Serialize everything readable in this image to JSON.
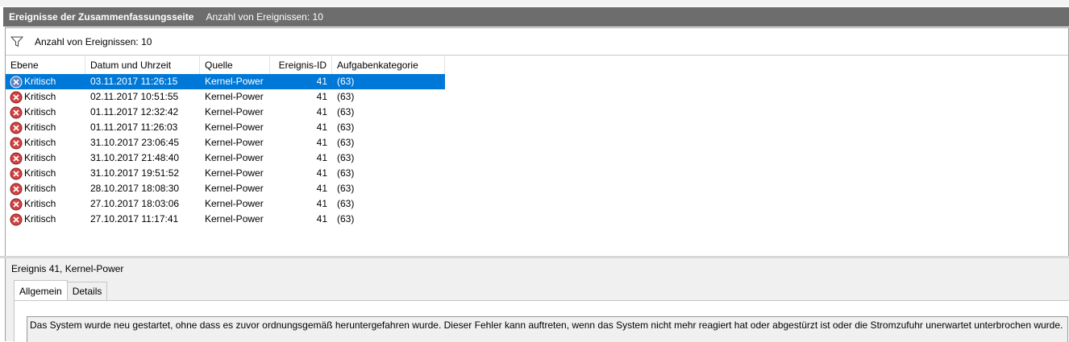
{
  "window": {
    "title": "Ereignisse der Zusammenfassungsseite",
    "count_label": "Anzahl von Ereignissen: 10"
  },
  "filter": {
    "icon": "filter-icon",
    "text": "Anzahl von Ereignissen: 10"
  },
  "table": {
    "columns": [
      "Ebene",
      "Datum und Uhrzeit",
      "Quelle",
      "Ereignis-ID",
      "Aufgabenkategorie"
    ],
    "rows": [
      {
        "level": "Kritisch",
        "datetime": "03.11.2017 11:26:15",
        "source": "Kernel-Power",
        "id": "41",
        "category": "(63)"
      },
      {
        "level": "Kritisch",
        "datetime": "02.11.2017 10:51:55",
        "source": "Kernel-Power",
        "id": "41",
        "category": "(63)"
      },
      {
        "level": "Kritisch",
        "datetime": "01.11.2017 12:32:42",
        "source": "Kernel-Power",
        "id": "41",
        "category": "(63)"
      },
      {
        "level": "Kritisch",
        "datetime": "01.11.2017 11:26:03",
        "source": "Kernel-Power",
        "id": "41",
        "category": "(63)"
      },
      {
        "level": "Kritisch",
        "datetime": "31.10.2017 23:06:45",
        "source": "Kernel-Power",
        "id": "41",
        "category": "(63)"
      },
      {
        "level": "Kritisch",
        "datetime": "31.10.2017 21:48:40",
        "source": "Kernel-Power",
        "id": "41",
        "category": "(63)"
      },
      {
        "level": "Kritisch",
        "datetime": "31.10.2017 19:51:52",
        "source": "Kernel-Power",
        "id": "41",
        "category": "(63)"
      },
      {
        "level": "Kritisch",
        "datetime": "28.10.2017 18:08:30",
        "source": "Kernel-Power",
        "id": "41",
        "category": "(63)"
      },
      {
        "level": "Kritisch",
        "datetime": "27.10.2017 18:03:06",
        "source": "Kernel-Power",
        "id": "41",
        "category": "(63)"
      },
      {
        "level": "Kritisch",
        "datetime": "27.10.2017 11:17:41",
        "source": "Kernel-Power",
        "id": "41",
        "category": "(63)"
      }
    ],
    "selected_index": 0,
    "level_icon": "critical-error-icon"
  },
  "detail": {
    "title": "Ereignis 41, Kernel-Power",
    "tabs": [
      "Allgemein",
      "Details"
    ],
    "active_tab": "Allgemein",
    "description": "Das System wurde neu gestartet, ohne dass es zuvor ordnungsgemäß heruntergefahren wurde. Dieser Fehler kann auftreten, wenn das System nicht mehr reagiert hat oder abgestürzt ist oder die Stromzufuhr unerwartet unterbrochen wurde."
  },
  "colors": {
    "title_bar": "#6d6d6d",
    "selection": "#0078d7",
    "critical": "#d24343"
  }
}
